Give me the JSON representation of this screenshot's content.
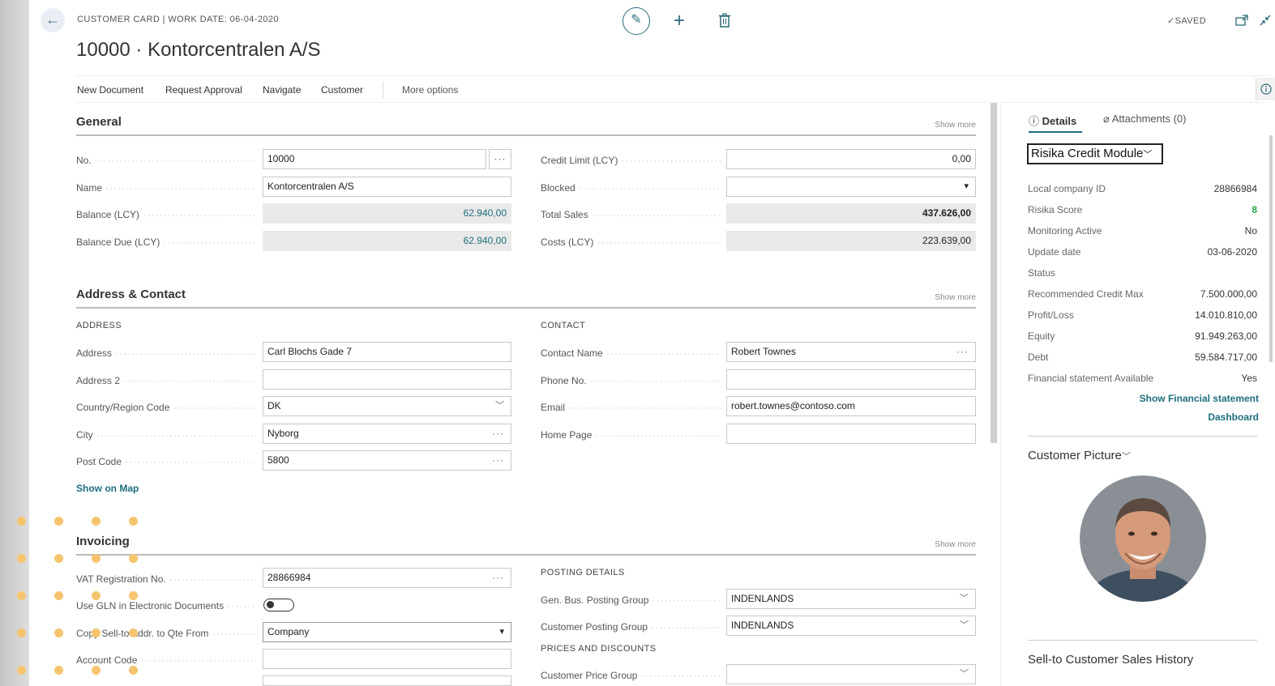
{
  "header": {
    "caption": "CUSTOMER CARD | WORK DATE: 06-04-2020",
    "title": "10000 · Kontorcentralen A/S",
    "saved": "✓SAVED"
  },
  "actions": [
    "New Document",
    "Request Approval",
    "Navigate",
    "Customer",
    "More options"
  ],
  "general": {
    "title": "General",
    "show_more": "Show more",
    "no_label": "No.",
    "no_value": "10000",
    "name_label": "Name",
    "name_value": "Kontorcentralen A/S",
    "balance_label": "Balance (LCY)",
    "balance_value": "62.940,00",
    "balance_due_label": "Balance Due (LCY)",
    "balance_due_value": "62.940,00",
    "credit_limit_label": "Credit Limit (LCY)",
    "credit_limit_value": "0,00",
    "blocked_label": "Blocked",
    "blocked_value": "",
    "total_sales_label": "Total Sales",
    "total_sales_value": "437.626,00",
    "costs_label": "Costs (LCY)",
    "costs_value": "223.639,00"
  },
  "address": {
    "title": "Address & Contact",
    "show_more": "Show more",
    "address_head": "ADDRESS",
    "contact_head": "CONTACT",
    "address_label": "Address",
    "address_value": "Carl Blochs Gade 7",
    "address2_label": "Address 2",
    "address2_value": "",
    "country_label": "Country/Region Code",
    "country_value": "DK",
    "city_label": "City",
    "city_value": "Nyborg",
    "post_label": "Post Code",
    "post_value": "5800",
    "show_map": "Show on Map",
    "contact_label": "Contact Name",
    "contact_value": "Robert Townes",
    "phone_label": "Phone No.",
    "phone_value": "",
    "email_label": "Email",
    "email_value": "robert.townes@contoso.com",
    "home_label": "Home Page",
    "home_value": ""
  },
  "invoicing": {
    "title": "Invoicing",
    "show_more": "Show more",
    "vat_label": "VAT Registration No.",
    "vat_value": "28866984",
    "gln_label": "Use GLN in Electronic Documents",
    "copy_label": "Copy Sell-to Addr. to Qte From",
    "copy_value": "Company",
    "account_label": "Account Code",
    "account_value": "",
    "posting_head": "POSTING DETAILS",
    "gen_bus_label": "Gen. Bus. Posting Group",
    "gen_bus_value": "INDENLANDS",
    "cust_posting_label": "Customer Posting Group",
    "cust_posting_value": "INDENLANDS",
    "prices_head": "PRICES AND DISCOUNTS",
    "price_group_label": "Customer Price Group",
    "price_group_value": ""
  },
  "factbox": {
    "details_tab": "Details",
    "attachments_tab": "Attachments (0)",
    "module": "Risika Credit Module",
    "rows": [
      {
        "k": "Local company ID",
        "v": "28866984"
      },
      {
        "k": "Risika Score",
        "v": "8"
      },
      {
        "k": "Monitoring Active",
        "v": "No"
      },
      {
        "k": "Update date",
        "v": "03-06-2020"
      },
      {
        "k": "Status",
        "v": ""
      },
      {
        "k": "Recommended Credit Max",
        "v": "7.500.000,00"
      },
      {
        "k": "Profit/Loss",
        "v": "14.010.810,00"
      },
      {
        "k": "Equity",
        "v": "91.949.263,00"
      },
      {
        "k": "Debt",
        "v": "59.584.717,00"
      },
      {
        "k": "Financial statement Available",
        "v": "Yes"
      }
    ],
    "show_fin": "Show Financial statement",
    "dashboard": "Dashboard",
    "picture_head": "Customer Picture",
    "sales_history": "Sell-to Customer Sales History"
  },
  "colors": {
    "accent": "#1d6f7c",
    "score": "#28a745",
    "dots": "#f6c46e"
  }
}
